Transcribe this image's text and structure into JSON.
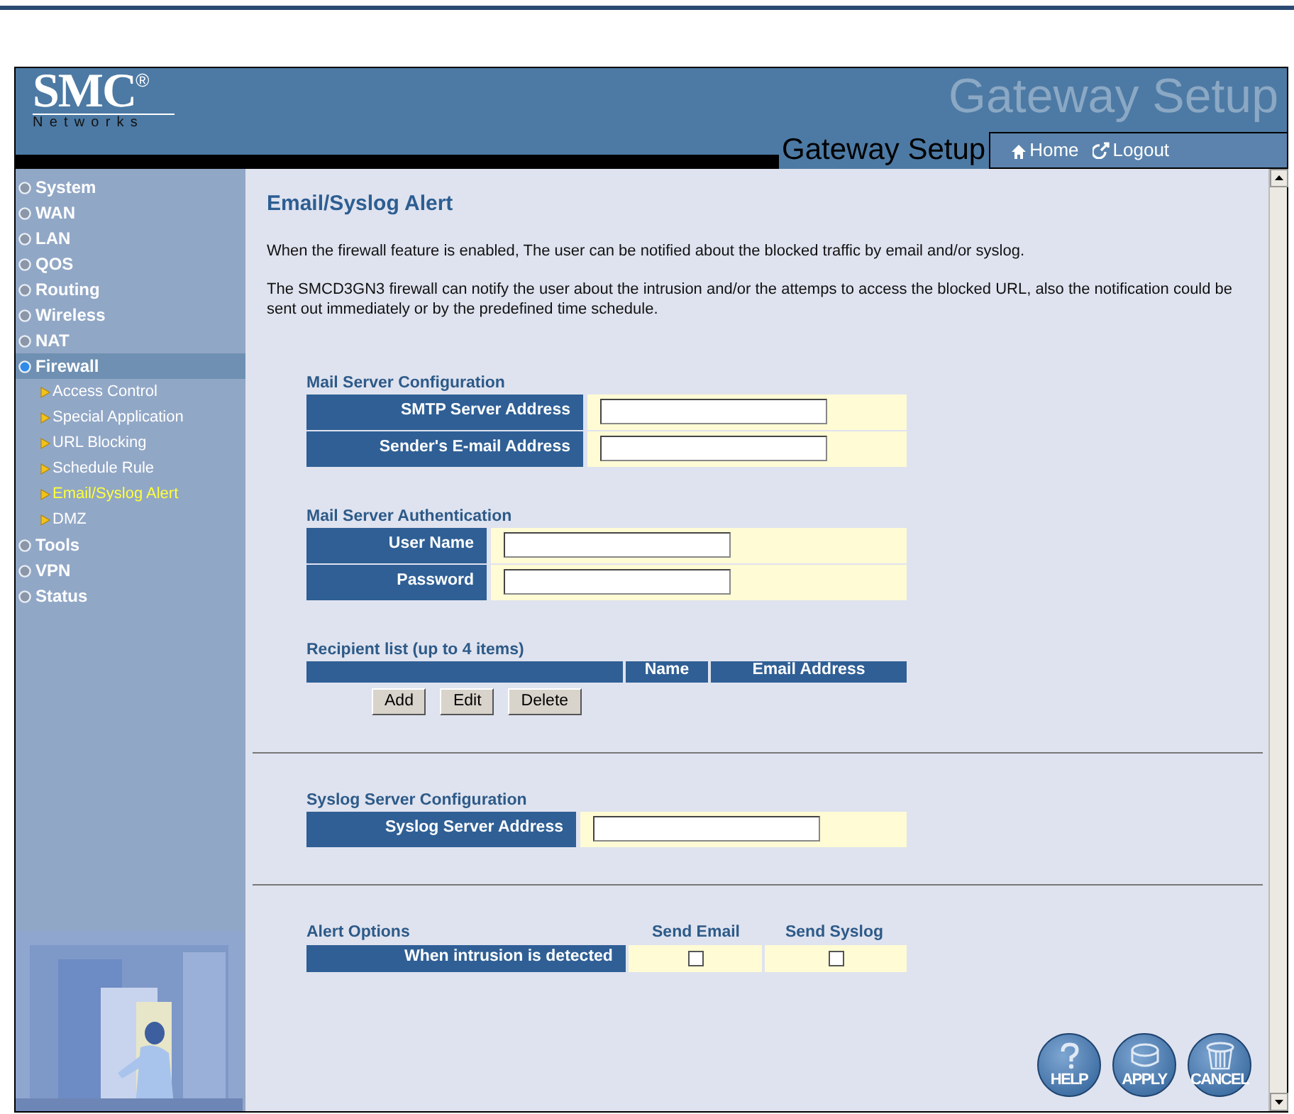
{
  "header": {
    "logo": "SMC",
    "logo_mark": "®",
    "logo_sub": "Networks",
    "banner_faded": "Gateway Setup",
    "banner_title": "Gateway Setup",
    "links": [
      {
        "label": "Home",
        "kind": "home"
      },
      {
        "label": "Logout",
        "kind": "logout"
      }
    ]
  },
  "sidebar": {
    "items": [
      {
        "label": "System",
        "selected": false
      },
      {
        "label": "WAN",
        "selected": false
      },
      {
        "label": "LAN",
        "selected": false
      },
      {
        "label": "QOS",
        "selected": false
      },
      {
        "label": "Routing",
        "selected": false
      },
      {
        "label": "Wireless",
        "selected": false
      },
      {
        "label": "NAT",
        "selected": false
      },
      {
        "label": "Firewall",
        "selected": true,
        "children": [
          {
            "label": "Access Control",
            "selected": false
          },
          {
            "label": "Special Application",
            "selected": false
          },
          {
            "label": "URL Blocking",
            "selected": false
          },
          {
            "label": "Schedule Rule",
            "selected": false
          },
          {
            "label": "Email/Syslog Alert",
            "selected": true
          },
          {
            "label": "DMZ",
            "selected": false
          }
        ]
      },
      {
        "label": "Tools",
        "selected": false
      },
      {
        "label": "VPN",
        "selected": false
      },
      {
        "label": "Status",
        "selected": false
      }
    ]
  },
  "page": {
    "title": "Email/Syslog Alert",
    "paragraphs": [
      "When the firewall feature is enabled, The user can be notified about the blocked traffic by email and/or syslog.",
      "The SMCD3GN3 firewall can notify the user about the intrusion and/or the attemps to access the blocked URL, also the notification could be sent out immediately or by the predefined time schedule."
    ]
  },
  "sections": [
    {
      "kind": "form",
      "heading": "Mail Server Configuration",
      "fields": [
        {
          "label": "SMTP Server Address"
        },
        {
          "label": "Sender's E-mail Address"
        }
      ]
    },
    {
      "kind": "form",
      "heading": "Mail Server Authentication",
      "fields": [
        {
          "label": "User Name"
        },
        {
          "label": "Password"
        }
      ]
    },
    {
      "kind": "list",
      "heading": "Recipient list (up to 4 items)",
      "columns": [
        "Name",
        "Email Address"
      ],
      "buttons": [
        "Add",
        "Edit",
        "Delete"
      ]
    },
    {
      "kind": "divider"
    },
    {
      "kind": "form",
      "heading": "Syslog Server Configuration",
      "fields": [
        {
          "label": "Syslog Server Address"
        }
      ]
    },
    {
      "kind": "divider"
    },
    {
      "kind": "options",
      "heading": "Alert Options",
      "columns": [
        "Send Email",
        "Send Syslog"
      ],
      "rows": [
        {
          "label": "When intrusion is detected",
          "checks": [
            false,
            false
          ]
        }
      ]
    }
  ],
  "actions": [
    {
      "label": "HELP",
      "kind": "help"
    },
    {
      "label": "APPLY",
      "kind": "apply"
    },
    {
      "label": "CANCEL",
      "kind": "cancel"
    }
  ]
}
